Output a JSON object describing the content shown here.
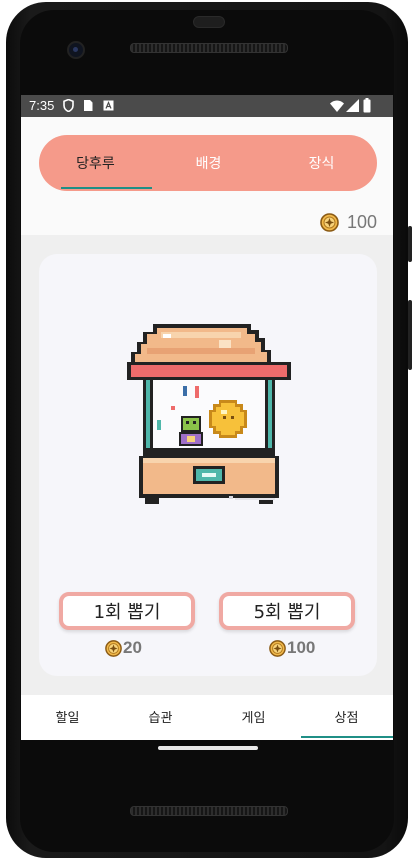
{
  "status_bar": {
    "time": "7:35"
  },
  "tabs": [
    {
      "label": "당후루",
      "active": true
    },
    {
      "label": "배경",
      "active": false
    },
    {
      "label": "장식",
      "active": false
    }
  ],
  "coins": {
    "balance": "100",
    "icon": "coin-icon"
  },
  "shop": {
    "draw_1": {
      "label": "1회 뽑기",
      "price": "20"
    },
    "draw_5": {
      "label": "5회 뽑기",
      "price": "100"
    }
  },
  "bottom_nav": [
    {
      "label": "할일",
      "active": false
    },
    {
      "label": "습관",
      "active": false
    },
    {
      "label": "게임",
      "active": false
    },
    {
      "label": "상점",
      "active": true
    }
  ],
  "colors": {
    "accent": "#f59a8a",
    "indicator": "#1f8f86",
    "button_border": "#f0a9a3"
  }
}
